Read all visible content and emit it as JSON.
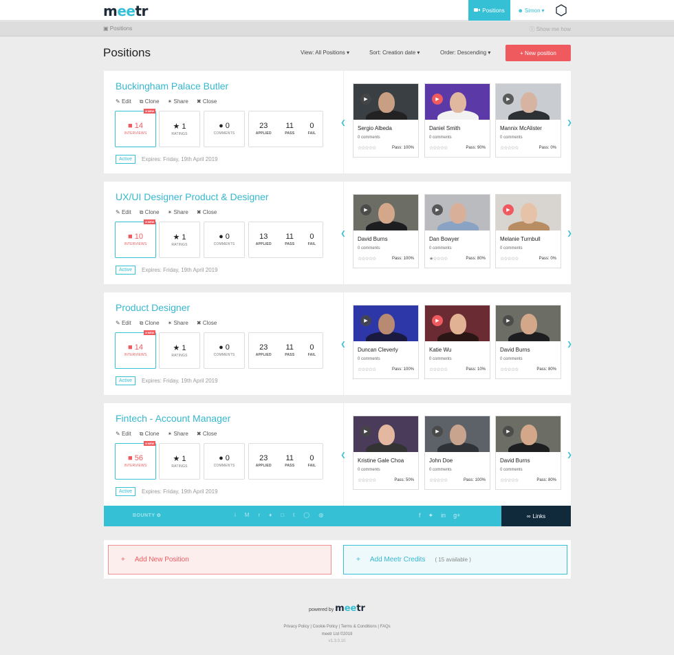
{
  "header": {
    "logo_pre": "m",
    "logo_e": "ee",
    "logo_post": "tr",
    "nav_positions": "Positions",
    "user": "Simon"
  },
  "breadcrumb": {
    "label": "Positions",
    "help": "Show me how"
  },
  "page": {
    "title": "Positions",
    "view": "View: All Positions",
    "sort": "Sort: Creation date",
    "order": "Order: Descending",
    "new_position": "+ New position"
  },
  "labels": {
    "edit": "Edit",
    "clone": "Clone",
    "share": "Share",
    "close": "Close",
    "interviews": "INTERVIEWS",
    "ratings": "RATINGS",
    "comments": "COMMENTS",
    "applied": "APPLIED",
    "pass": "PASS",
    "fail": "FAIL",
    "active": "Active",
    "expires": "Expires: Friday, 19th April 2019",
    "new": "8 NEW"
  },
  "positions": [
    {
      "title": "Buckingham Palace Butler",
      "interviews": "14",
      "ratings": "1",
      "comments": "0",
      "applied": "23",
      "pass": "11",
      "fail": "0",
      "candidates": [
        {
          "name": "Sergio Albeda",
          "comments": "0 comments",
          "stars": "☆☆☆☆☆",
          "pass": "Pass: 100%",
          "bg": "#3a3f44",
          "skin": "#c99f83",
          "shirt": "#222",
          "play": "grey"
        },
        {
          "name": "Daniel Smith",
          "comments": "0 comments",
          "stars": "☆☆☆☆☆",
          "pass": "Pass: 90%",
          "bg": "#5b3aa8",
          "skin": "#e0b8a0",
          "shirt": "#f2f2f2",
          "play": "red"
        },
        {
          "name": "Mannix McAlister",
          "comments": "0 comments",
          "stars": "☆☆☆☆☆",
          "pass": "Pass: 0%",
          "bg": "#c9ccd1",
          "skin": "#d7b3a1",
          "shirt": "#2d3134",
          "play": "grey"
        }
      ]
    },
    {
      "title": "UX/UI Designer Product & Designer",
      "interviews": "10",
      "ratings": "1",
      "comments": "0",
      "applied": "13",
      "pass": "11",
      "fail": "0",
      "candidates": [
        {
          "name": "David Burns",
          "comments": "0 comments",
          "stars": "☆☆☆☆☆",
          "pass": "Pass: 100%",
          "bg": "#6c6e66",
          "skin": "#d3a78a",
          "shirt": "#1c1e20",
          "play": "grey"
        },
        {
          "name": "Dan Bowyer",
          "comments": "0 comments",
          "stars": "★☆☆☆☆",
          "pass": "Pass: 80%",
          "bg": "#b9bbbe",
          "skin": "#d8b09a",
          "shirt": "#8aa3c4",
          "play": "grey"
        },
        {
          "name": "Melanie Turnbull",
          "comments": "0 comments",
          "stars": "☆☆☆☆☆",
          "pass": "Pass: 0%",
          "bg": "#d8d5d0",
          "skin": "#e6c2a8",
          "shirt": "#b98d63",
          "play": "red"
        }
      ]
    },
    {
      "title": "Product Designer",
      "interviews": "14",
      "ratings": "1",
      "comments": "0",
      "applied": "23",
      "pass": "11",
      "fail": "0",
      "candidates": [
        {
          "name": "Duncan Cleverly",
          "comments": "0 comments",
          "stars": "☆☆☆☆☆",
          "pass": "Pass: 100%",
          "bg": "#2d37a8",
          "skin": "#b98a72",
          "shirt": "#1a1a40",
          "play": "grey"
        },
        {
          "name": "Katie Wu",
          "comments": "0 comments",
          "stars": "☆☆☆☆☆",
          "pass": "Pass: 10%",
          "bg": "#6a2c32",
          "skin": "#e2b294",
          "shirt": "#2b1616",
          "play": "red"
        },
        {
          "name": "David Burns",
          "comments": "0 comments",
          "stars": "☆☆☆☆☆",
          "pass": "Pass: 80%",
          "bg": "#6c6e66",
          "skin": "#d3a78a",
          "shirt": "#1c1e20",
          "play": "grey"
        }
      ]
    },
    {
      "title": "Fintech - Account Manager",
      "interviews": "56",
      "ratings": "1",
      "comments": "0",
      "applied": "23",
      "pass": "11",
      "fail": "0",
      "candidates": [
        {
          "name": "Kristine Gale Choa",
          "comments": "0 comments",
          "stars": "☆☆☆☆☆",
          "pass": "Pass: 50%",
          "bg": "#4a3b5a",
          "skin": "#e4b7a0",
          "shirt": "#333",
          "play": "grey"
        },
        {
          "name": "John Doe",
          "comments": "0 comments",
          "stars": "☆☆☆☆☆",
          "pass": "Pass: 100%",
          "bg": "#5d6168",
          "skin": "#c8a38e",
          "shirt": "#2f3236",
          "play": "grey"
        },
        {
          "name": "David Burns",
          "comments": "0 comments",
          "stars": "☆☆☆☆☆",
          "pass": "Pass: 80%",
          "bg": "#6c6e66",
          "skin": "#d3a78a",
          "shirt": "#1c1e20",
          "play": "grey"
        }
      ]
    }
  ],
  "footer_bar": {
    "brand": "BOUNTY",
    "links": "Links"
  },
  "add": {
    "new_position": "Add New Position",
    "credits": "Add Meetr Credits",
    "available": "( 15 available )"
  },
  "page_footer": {
    "powered": "powered by",
    "links": "Privacy Policy | Cookie Policy | Terms & Conditions | FAQs",
    "copyright": "meetr Ltd ©2019",
    "version": "v1.3.0.10"
  },
  "colors": {
    "accent": "#35c0d6",
    "danger": "#ef5a5f",
    "navy": "#112a3b"
  }
}
